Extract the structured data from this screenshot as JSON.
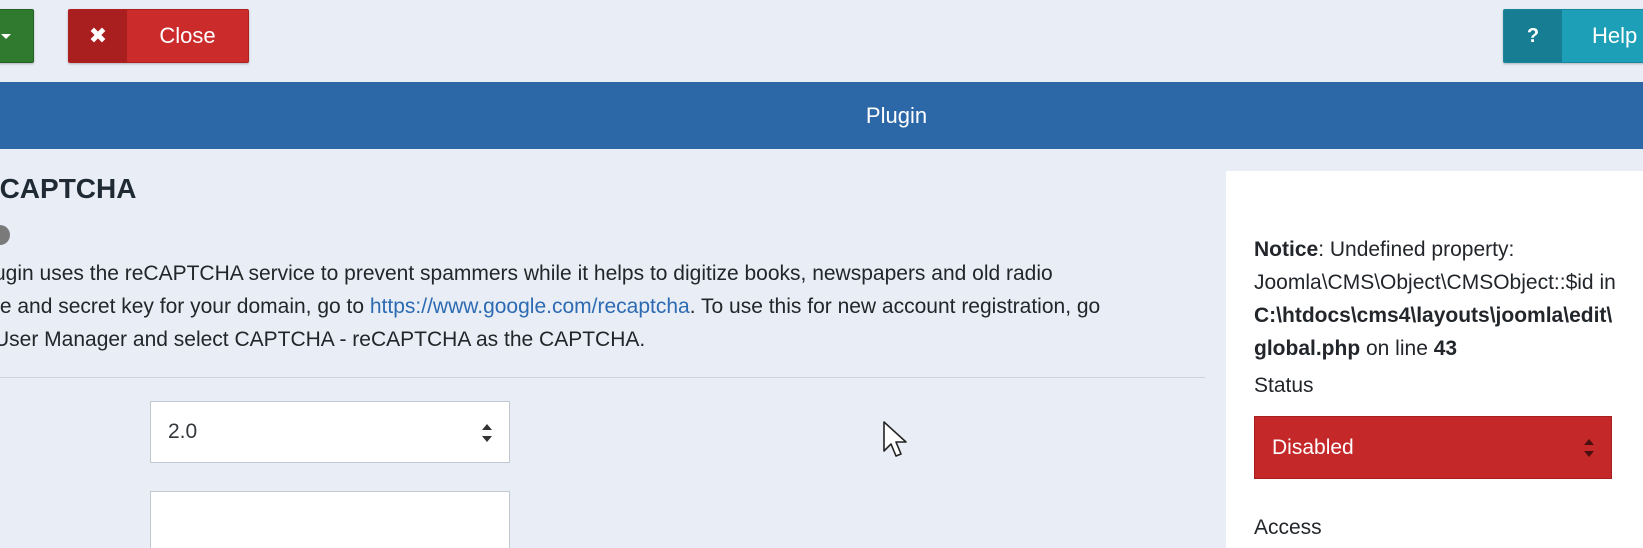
{
  "toolbar": {
    "close_label": "Close",
    "close_icon": "✖",
    "help_label": "Help",
    "help_icon": "?"
  },
  "header": {
    "title": "Plugin"
  },
  "plugin": {
    "title": "eCAPTCHA",
    "description": {
      "line1": "ugin uses the reCAPTCHA service to prevent spammers while it helps to digitize books, newspapers and old radio",
      "line2_before": "te and secret key for your domain, go to ",
      "link": "https://www.google.com/recaptcha",
      "line2_after": ". To use this for new account registration, go",
      "line3": "User Manager and select CAPTCHA - reCAPTCHA as the CAPTCHA."
    },
    "version_value": "2.0",
    "key_value": ""
  },
  "sidebar": {
    "notice": {
      "label": "Notice",
      "text1": ": Undefined property:",
      "text2": "Joomla\\CMS\\Object\\CMSObject::$id in",
      "path1": "C:\\htdocs\\cms4\\layouts\\joomla\\edit\\",
      "path2": "global.php",
      "on_line": " on line ",
      "line_no": "43"
    },
    "status_label": "Status",
    "status_value": "Disabled",
    "access_label": "Access"
  },
  "colors": {
    "header_bg": "#2c68a8",
    "close_red": "#cc2b2b",
    "help_teal": "#1e9fb8",
    "status_disabled": "#c52828",
    "link": "#2c6bb3"
  }
}
